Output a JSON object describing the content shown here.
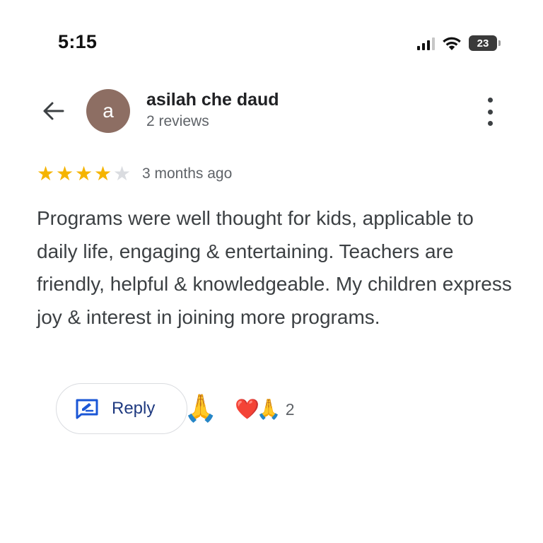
{
  "status_bar": {
    "time": "5:15",
    "battery": "23",
    "icons": [
      "cellular-signal-icon",
      "wifi-icon",
      "battery-icon"
    ]
  },
  "header": {
    "back_icon": "arrow-left-icon",
    "avatar_letter": "a",
    "avatar_color": "#8d6e63",
    "name": "asilah che daud",
    "review_count": "2 reviews",
    "menu_icon": "more-vertical-icon"
  },
  "review": {
    "rating": 4,
    "max_rating": 5,
    "star_color": "#f5b400",
    "date": "3 months ago",
    "text": "Programs were well thought for kids, applicable to daily life, engaging & entertaining. Teachers are friendly, helpful & knowledgeable. My children express joy & interest in joining more programs."
  },
  "actions": {
    "reply_label": "Reply",
    "reply_icon": "reply-edit-icon",
    "add_reaction_emoji": "🙏",
    "reaction_emojis": [
      "❤️",
      "🙏"
    ],
    "reaction_count": "2",
    "accent_color": "#1a56d6"
  }
}
